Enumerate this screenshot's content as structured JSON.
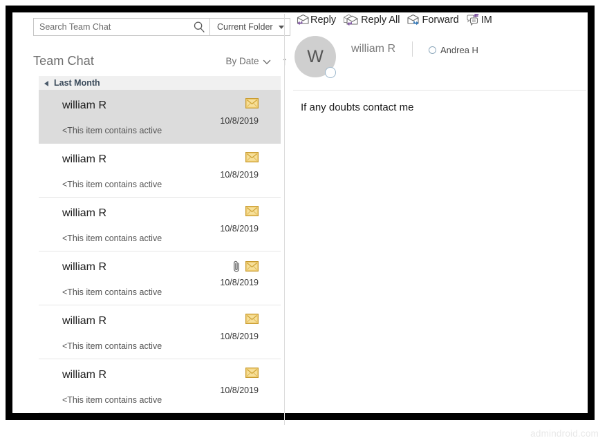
{
  "search": {
    "placeholder": "Search Team Chat",
    "value": "",
    "icon": "search-icon",
    "scope_label": "Current Folder",
    "scope_caret_icon": "chevron-down-icon"
  },
  "list_header": {
    "folder_title": "Team Chat",
    "sort_label": "By Date",
    "sort_caret_icon": "chevron-down-icon",
    "sort_direction_glyph": "↑",
    "sort_direction_name": "arrow-up-icon"
  },
  "group": {
    "label": "Last Month",
    "collapse_icon": "triangle-collapse-icon"
  },
  "messages": [
    {
      "sender": "william R",
      "preview": "<This item contains active",
      "date": "10/8/2019",
      "unread_icon": "envelope-icon",
      "has_attachment": false,
      "selected": true
    },
    {
      "sender": "william R",
      "preview": "<This item contains active",
      "date": "10/8/2019",
      "unread_icon": "envelope-icon",
      "has_attachment": false,
      "selected": false
    },
    {
      "sender": "william R",
      "preview": "<This item contains active",
      "date": "10/8/2019",
      "unread_icon": "envelope-icon",
      "has_attachment": false,
      "selected": false
    },
    {
      "sender": "william R",
      "preview": "<This item contains active",
      "date": "10/8/2019",
      "unread_icon": "envelope-icon",
      "has_attachment": true,
      "attachment_icon": "paperclip-icon",
      "selected": false
    },
    {
      "sender": "william R",
      "preview": "<This item contains active",
      "date": "10/8/2019",
      "unread_icon": "envelope-icon",
      "has_attachment": false,
      "selected": false
    },
    {
      "sender": "william R",
      "preview": "<This item contains active",
      "date": "10/8/2019",
      "unread_icon": "envelope-icon",
      "has_attachment": false,
      "selected": false
    }
  ],
  "reading_pane": {
    "toolbar": [
      {
        "label": "Reply",
        "icon": "reply-icon"
      },
      {
        "label": "Reply All",
        "icon": "reply-all-icon"
      },
      {
        "label": "Forward",
        "icon": "forward-icon"
      },
      {
        "label": "IM",
        "icon": "instant-message-icon"
      }
    ],
    "avatar_initial": "W",
    "avatar_name": "avatar",
    "presence_icon": "presence-status-icon",
    "sender_name": "william R",
    "recipient_name": "Andrea H",
    "recipient_icon": "contact-circle-icon",
    "body_text": "If any doubts contact me"
  },
  "watermark": "admindroid.com",
  "colors": {
    "envelope_gold": "#e8b33c",
    "reply_arrow_purple": "#7b519d",
    "forward_arrow_blue": "#2e75b6",
    "selection_gray": "#dcdcdc",
    "group_header_gray": "#f0f0f0",
    "frame_black": "#000000"
  }
}
